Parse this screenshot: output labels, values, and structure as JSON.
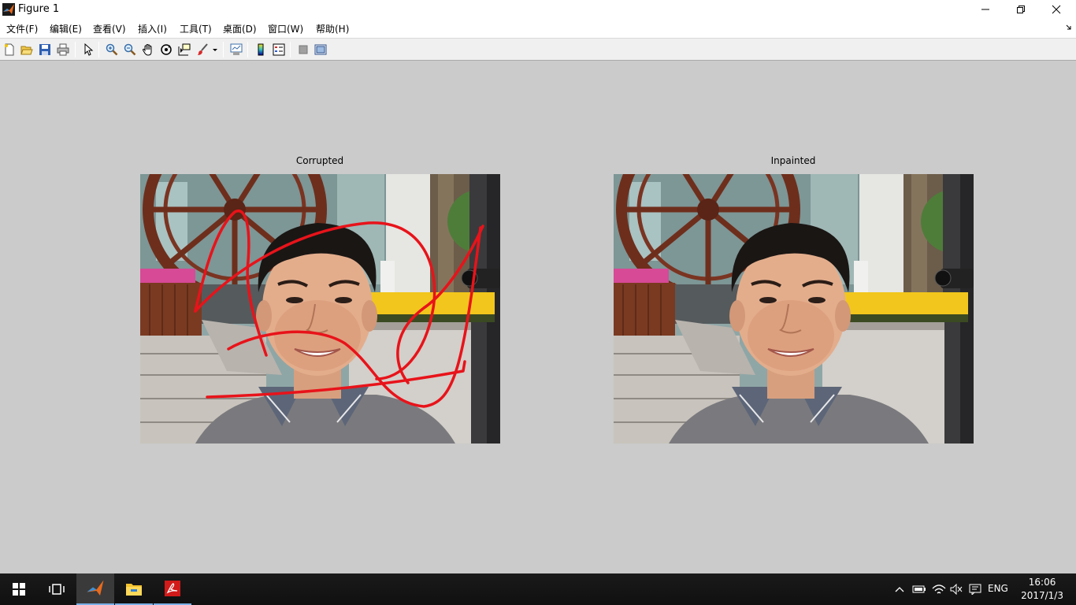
{
  "window": {
    "title": "Figure 1"
  },
  "menu": [
    {
      "label": "文件(F)"
    },
    {
      "label": "编辑(E)"
    },
    {
      "label": "查看(V)"
    },
    {
      "label": "插入(I)"
    },
    {
      "label": "工具(T)"
    },
    {
      "label": "桌面(D)"
    },
    {
      "label": "窗口(W)"
    },
    {
      "label": "帮助(H)"
    }
  ],
  "toolbar": {
    "icons": [
      "new-figure-icon",
      "open-file-icon",
      "save-icon",
      "print-icon",
      "pointer-icon",
      "zoom-in-icon",
      "zoom-out-icon",
      "pan-hand-icon",
      "rotate-3d-icon",
      "data-cursor-icon",
      "brush-icon",
      "link-plot-icon",
      "colorbar-icon",
      "legend-icon",
      "hide-plot-tools-icon",
      "show-plot-tools-icon"
    ]
  },
  "figure": {
    "left_title": "Corrupted",
    "right_title": "Inpainted"
  },
  "taskbar": {
    "apps": [
      "start-icon",
      "task-view-icon",
      "matlab-icon",
      "file-explorer-icon",
      "acrobat-icon"
    ],
    "language": "ENG",
    "time": "16:06",
    "date": "2017/1/3"
  },
  "colors": {
    "figure_bg": "#cbcbcb",
    "scribble": "#e8131a",
    "taskbar": "#101010"
  }
}
